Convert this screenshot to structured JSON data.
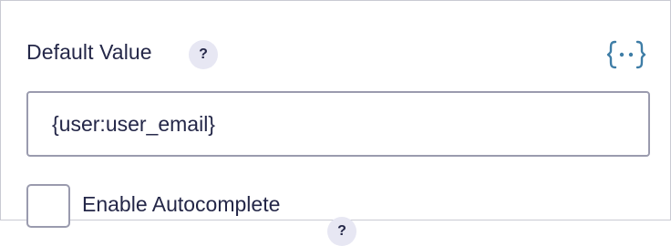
{
  "default_value": {
    "label": "Default Value",
    "help_glyph": "?",
    "merge_tag_icon": "merge-tag-braces-icon",
    "input_value": "{user:user_email}"
  },
  "autocomplete": {
    "label": "Enable Autocomplete",
    "help_glyph": "?",
    "checked": false
  },
  "colors": {
    "text": "#242748",
    "badge_bg": "#e7e7f3",
    "border": "#9a9bae",
    "panel_border": "#c9cad3",
    "icon": "#3e7da6"
  }
}
